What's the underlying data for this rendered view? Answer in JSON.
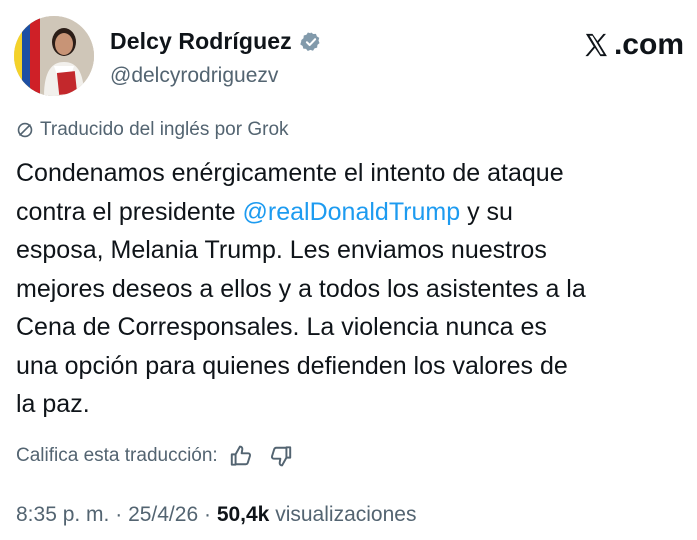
{
  "author": {
    "display_name": "Delcy Rodríguez",
    "handle": "@delcyrodriguezv",
    "verified": true,
    "avatar_icon": "profile-photo"
  },
  "brand": {
    "label": ".com",
    "icon": "x-logo-icon"
  },
  "translation": {
    "label": "Traducido del inglés por Grok",
    "icon": "translate-icon"
  },
  "tweet": {
    "lines": [
      [
        "Condenamos enérgicamente el intento de ataque"
      ],
      [
        "contra el presidente ",
        "@realDonaldTrump",
        " y su"
      ],
      [
        "esposa, Melania Trump. Les enviamos nuestros"
      ],
      [
        "mejores deseos a ellos y a todos los asistentes a la"
      ],
      [
        "Cena de Corresponsales. La violencia nunca es"
      ],
      [
        "una opción para quienes defienden los valores de"
      ],
      [
        "la paz."
      ]
    ]
  },
  "rating": {
    "label": "Califica esta traducción:",
    "thumbs_up_icon": "thumbs-up-icon",
    "thumbs_down_icon": "thumbs-down-icon"
  },
  "meta": {
    "time": "8:35 p. m.",
    "sep1": " · ",
    "date": "25/4/26",
    "sep2": " · ",
    "views_count": "50,4k",
    "views_label": " visualizaciones"
  },
  "colors": {
    "text": "#0f1419",
    "secondary": "#536471",
    "link": "#1d9bf0",
    "verified": "#829aab"
  }
}
